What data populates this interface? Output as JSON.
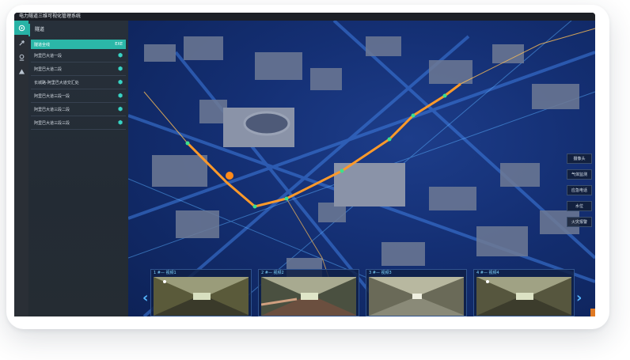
{
  "app": {
    "title": "电力隧道三维可视化管理系统"
  },
  "rail": {
    "items": [
      {
        "icon": "home-icon",
        "active": true
      },
      {
        "icon": "tools-icon",
        "active": false
      },
      {
        "icon": "location-icon",
        "active": false
      },
      {
        "icon": "warning-icon",
        "active": false
      }
    ]
  },
  "panel": {
    "header": "隧道",
    "routes": [
      {
        "label": "隧道全线",
        "badge": "EXE",
        "selected": true
      },
      {
        "label": "阿里巴大道一段",
        "selected": false
      },
      {
        "label": "阿里巴大道二段",
        "selected": false
      },
      {
        "label": "长城路-阿里巴大道交汇处",
        "selected": false
      },
      {
        "label": "阿里巴大道三段一段",
        "selected": false
      },
      {
        "label": "阿里巴大道三段二段",
        "selected": false
      },
      {
        "label": "阿里巴大道三段三段",
        "selected": false
      }
    ]
  },
  "layers": [
    "摄像头",
    "气体监测",
    "应急电话",
    "水位",
    "火灾报警"
  ],
  "cameras": [
    {
      "label": "1 #— 视频1"
    },
    {
      "label": "2 #— 视频2"
    },
    {
      "label": "3 #— 视频3"
    },
    {
      "label": "4 #— 视频4"
    }
  ],
  "colors": {
    "accent": "#28b3a6",
    "route": "#ff9a2a",
    "map": "#142f73"
  }
}
